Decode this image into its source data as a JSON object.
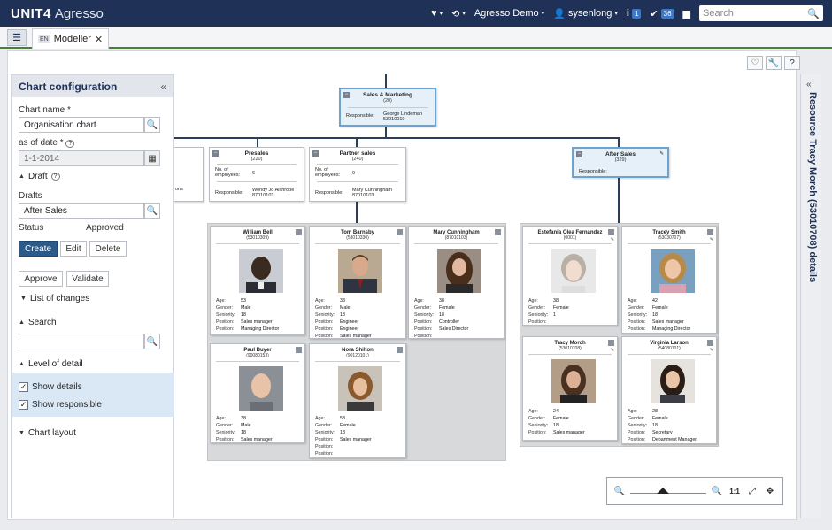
{
  "topbar": {
    "brand_main": "unit4",
    "brand_sub": "Agresso",
    "company": "Agresso Demo",
    "user": "sysenlong",
    "info_badge": "1",
    "tasks_badge": "36",
    "search_placeholder": "Search"
  },
  "tabs": {
    "active_lang": "EN",
    "active_label": "Modeller"
  },
  "panel": {
    "title": "Chart configuration",
    "chart_name_label": "Chart name *",
    "chart_name_value": "Organisation chart",
    "as_of_date_label": "as of date *",
    "as_of_date_value": "1-1-2014",
    "draft_section": "Draft",
    "drafts_label": "Drafts",
    "drafts_value": "After Sales",
    "status_label": "Status",
    "status_value": "Approved",
    "btn_create": "Create",
    "btn_edit": "Edit",
    "btn_delete": "Delete",
    "btn_approve": "Approve",
    "btn_validate": "Validate",
    "list_of_changes": "List of changes",
    "search_section": "Search",
    "level_of_detail": "Level of detail",
    "show_details": "Show details",
    "show_responsible": "Show responsible",
    "chart_layout": "Chart layout"
  },
  "rail": {
    "title": "Resource Tracy Morch (53010708) details"
  },
  "org": {
    "root": {
      "name": "Sales & Marketing",
      "code": "(20)",
      "resp_label": "Responsible:",
      "resp_name": "George Lindeman",
      "resp_id": "53010010"
    },
    "units": [
      {
        "name": "Presales",
        "code": "(220)",
        "emp_label": "No. of employees:",
        "emp_value": "6",
        "resp_label": "Responsible:",
        "resp_name": "Wendy Jo Allthrope",
        "resp_id": "87010103"
      },
      {
        "name": "Partner sales",
        "code": "(240)",
        "emp_label": "No. of employees:",
        "emp_value": "9",
        "resp_label": "Responsible:",
        "resp_name": "Mary Cunningham",
        "resp_id": "87010103"
      },
      {
        "name": "After Sales",
        "code": "(329)",
        "resp_label": "Responsible:"
      }
    ],
    "left_stub": "ons",
    "people": [
      {
        "name": "William Bell",
        "id": "(53010309)",
        "age": "53",
        "gender": "Male",
        "seniority": "18",
        "position1": "Sales manager",
        "position2": "Managing Director"
      },
      {
        "name": "Tom Barnsby",
        "id": "(53010330)",
        "age": "38",
        "gender": "Male",
        "seniority": "18",
        "position1": "Engineer",
        "position2": "Engineer",
        "position3": "Sales manager"
      },
      {
        "name": "Mary Cunningham",
        "id": "(87010103)",
        "age": "38",
        "gender": "Female",
        "seniority": "18",
        "position1": "Controller",
        "position2": "Sales Director"
      },
      {
        "name": "Paul Buyer",
        "id": "(90080153)",
        "age": "38",
        "gender": "Male",
        "seniority": "18",
        "position1": "Sales manager"
      },
      {
        "name": "Nora Shilton",
        "id": "(90120101)",
        "age": "58",
        "gender": "Female",
        "seniority": "18",
        "position1": "Sales manager"
      },
      {
        "name": "Estefania Olea Fernández",
        "id": "(0001)",
        "age": "38",
        "gender": "Female",
        "seniority": "1"
      },
      {
        "name": "Tracey Smith",
        "id": "(53030707)",
        "age": "42",
        "gender": "Female",
        "seniority": "18",
        "position1": "Sales manager",
        "position2": "Managing Director"
      },
      {
        "name": "Tracy Morch",
        "id": "(53010708)",
        "age": "24",
        "gender": "Female",
        "seniority": "18",
        "position1": "Sales manager"
      },
      {
        "name": "Virginia Larson",
        "id": "(54080101)",
        "age": "28",
        "gender": "Female",
        "seniority": "18",
        "position1": "Secretary",
        "position2": "Department Manager"
      }
    ],
    "labels": {
      "age": "Age:",
      "gender": "Gender:",
      "seniority": "Seniority:",
      "position": "Position:"
    }
  },
  "zoom": {
    "one_to_one": "1:1"
  },
  "colors": {
    "topbar": "#1f3157",
    "accent_green": "#4a7e3a",
    "primary_button": "#2c5b8a",
    "selected_node": "#6ea2cf"
  }
}
